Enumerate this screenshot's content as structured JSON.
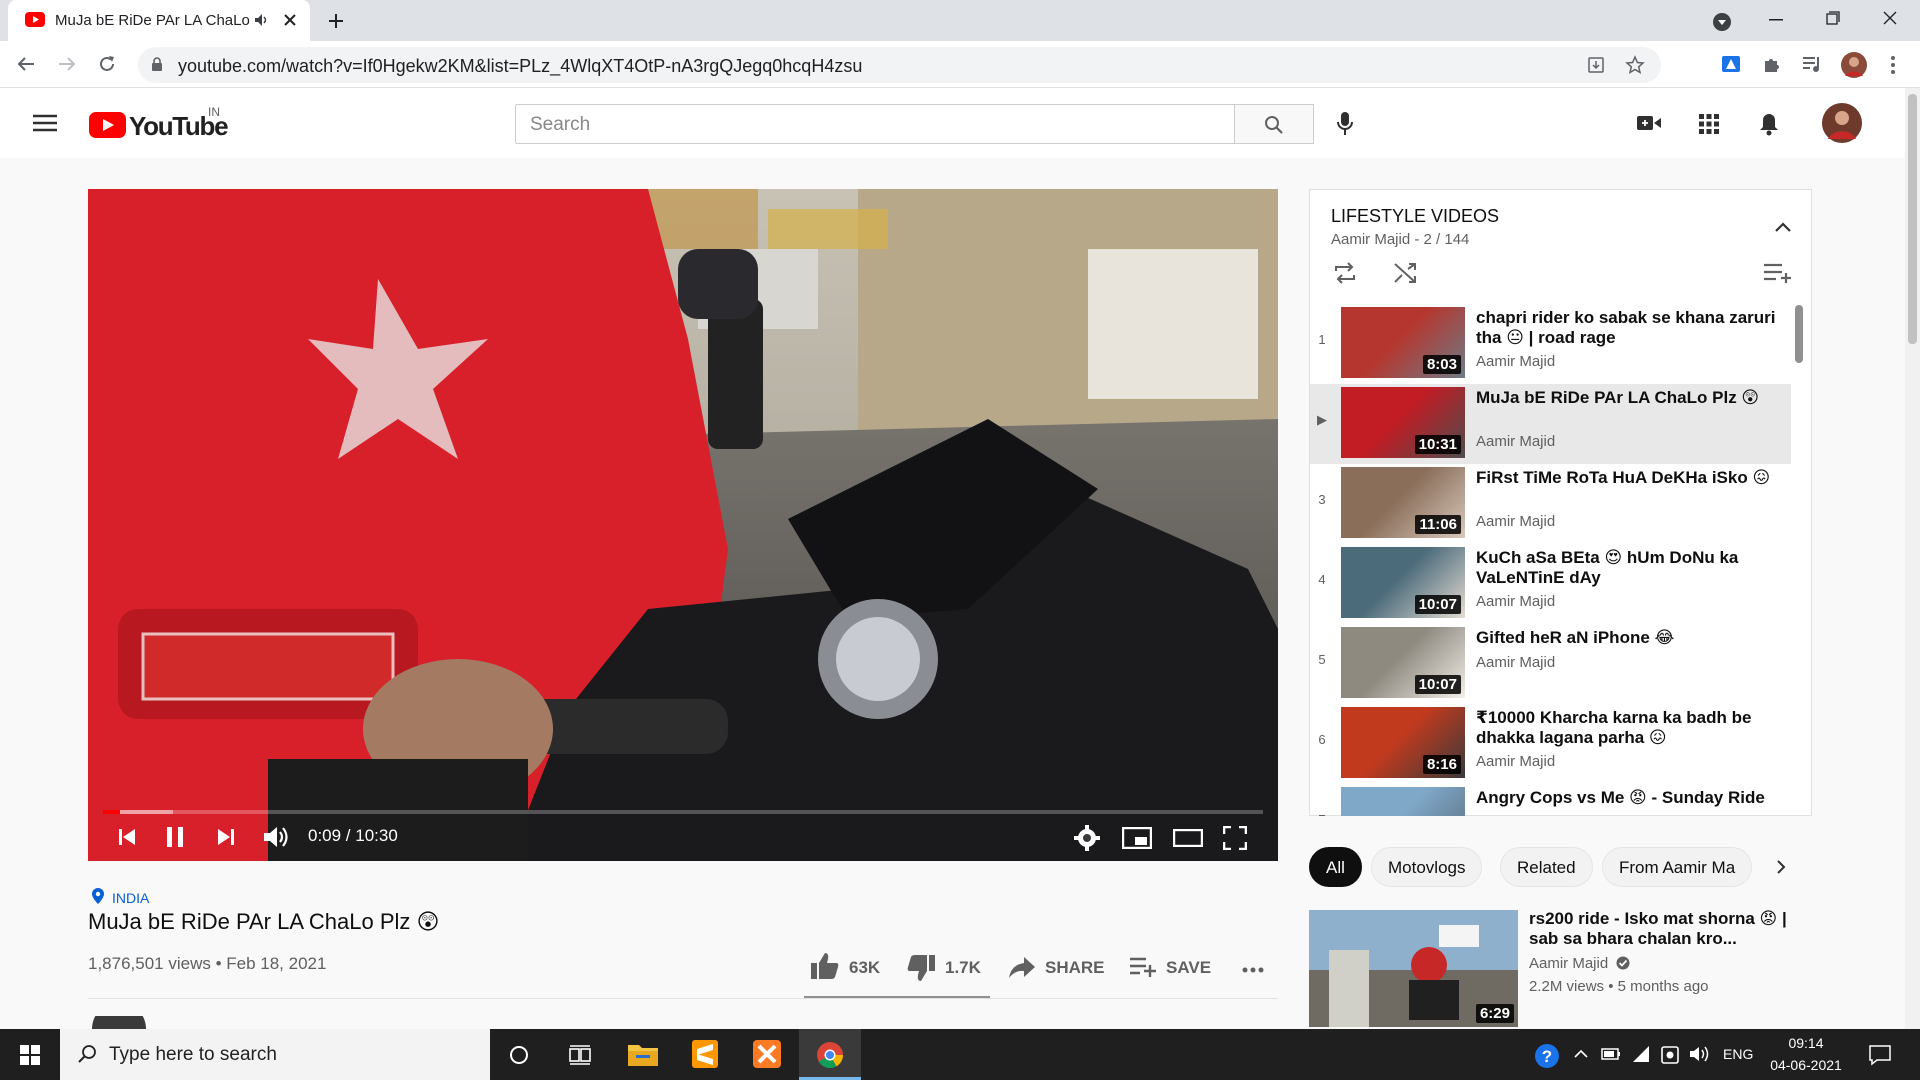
{
  "browser": {
    "tab_title": "MuJa bE RiDe PAr LA ChaLo",
    "url": "youtube.com/watch?v=If0Hgekw2KM&list=PLz_4WlqXT4OtP-nA3rgQJegq0hcqH4zsu"
  },
  "header": {
    "logo_text": "YouTube",
    "region": "IN",
    "search_placeholder": "Search"
  },
  "player": {
    "time": "0:09 / 10:30",
    "progress_fraction": 0.0143,
    "buffered_fraction": 0.06
  },
  "video": {
    "location": "INDIA",
    "title": "MuJa bE RiDe PAr LA ChaLo Plz 😲",
    "views_date": "1,876,501 views • Feb 18, 2021",
    "likes": "63K",
    "dislikes": "1.7K",
    "share_label": "SHARE",
    "save_label": "SAVE"
  },
  "playlist": {
    "title": "LIFESTYLE VIDEOS",
    "subtitle": "Aamir Majid - 2 / 144",
    "items": [
      {
        "index": "1",
        "title": "chapri rider ko sabak se khana zaruri tha 😐 | road rage",
        "channel": "Aamir Majid",
        "duration": "8:03"
      },
      {
        "index": "▶",
        "title": "MuJa bE RiDe PAr LA ChaLo Plz 😲",
        "channel": "Aamir Majid",
        "duration": "10:31"
      },
      {
        "index": "3",
        "title": "FiRst TiMe RoTa HuA DeKHa iSko 😖",
        "channel": "Aamir Majid",
        "duration": "11:06"
      },
      {
        "index": "4",
        "title": "KuCh aSa BEta 😍 hUm DoNu ka VaLeNTinE dAy",
        "channel": "Aamir Majid",
        "duration": "10:07"
      },
      {
        "index": "5",
        "title": "Gifted heR aN iPhone 😂",
        "channel": "Aamir Majid",
        "duration": "10:07"
      },
      {
        "index": "6",
        "title": "₹10000 Kharcha karna ka badh be dhakka lagana parha 😖",
        "channel": "Aamir Majid",
        "duration": "8:16"
      },
      {
        "index": "7",
        "title": "Angry Cops vs Me 😡 - Sunday Ride",
        "channel": "",
        "duration": ""
      }
    ]
  },
  "chips": [
    "All",
    "Motovlogs",
    "Related",
    "From Aamir Ma"
  ],
  "related": {
    "title": "rs200 ride - Isko mat shorna 😡 | sab sa bhara chalan kro...",
    "channel": "Aamir Majid",
    "meta": "2.2M views • 5 months ago",
    "duration": "6:29"
  },
  "taskbar": {
    "search_placeholder": "Type here to search",
    "language": "ENG",
    "time": "09:14",
    "date": "04-06-2021"
  }
}
